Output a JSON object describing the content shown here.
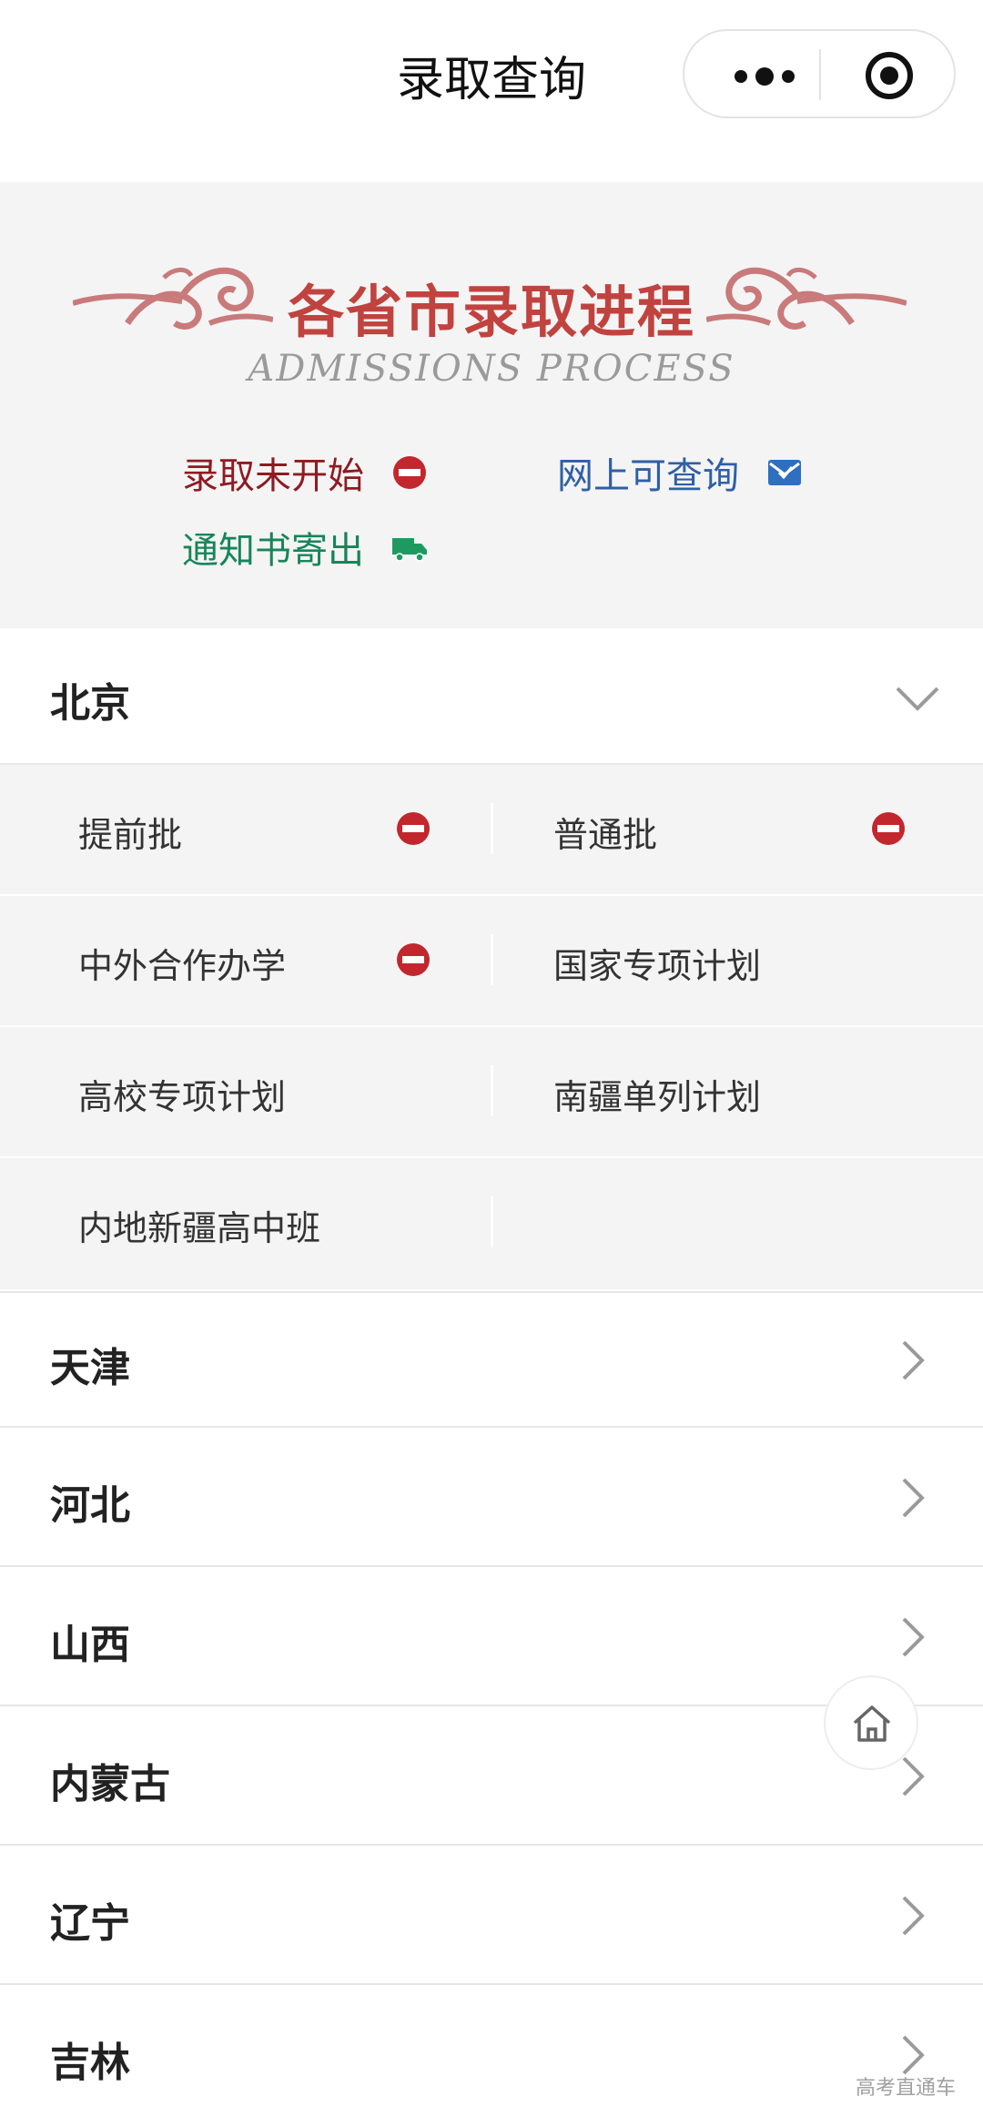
{
  "topbar": {
    "title": "录取查询",
    "more_icon": "more-dots-icon",
    "close_icon": "target-circle-icon"
  },
  "banner": {
    "title": "各省市录取进程",
    "subtitle": "ADMISSIONS PROCESS",
    "title_color": "#c0433f"
  },
  "legend": {
    "not_started": {
      "label": "录取未开始",
      "icon": "no-entry-icon",
      "color": "#8e1b22"
    },
    "online": {
      "label": "网上可查询",
      "icon": "mail-check-icon",
      "color": "#2f5fa5"
    },
    "mailed": {
      "label": "通知书寄出",
      "icon": "truck-icon",
      "color": "#17855a"
    }
  },
  "provinces": {
    "beijing": {
      "name": "北京",
      "expanded": true
    },
    "tianjin": {
      "name": "天津"
    },
    "hebei": {
      "name": "河北"
    },
    "shanxi": {
      "name": "山西"
    },
    "neimenggu": {
      "name": "内蒙古"
    },
    "liaoning": {
      "name": "辽宁"
    },
    "jilin": {
      "name": "吉林"
    }
  },
  "beijing_batches": {
    "b1": {
      "label": "提前批",
      "status": "not_started"
    },
    "b2": {
      "label": "普通批",
      "status": "not_started"
    },
    "b3": {
      "label": "中外合作办学",
      "status": "not_started"
    },
    "b4": {
      "label": "国家专项计划"
    },
    "b5": {
      "label": "高校专项计划"
    },
    "b6": {
      "label": "南疆单列计划"
    },
    "b7": {
      "label": "内地新疆高中班"
    }
  },
  "floating": {
    "home_icon": "home-icon"
  },
  "watermark": "高考直通车"
}
